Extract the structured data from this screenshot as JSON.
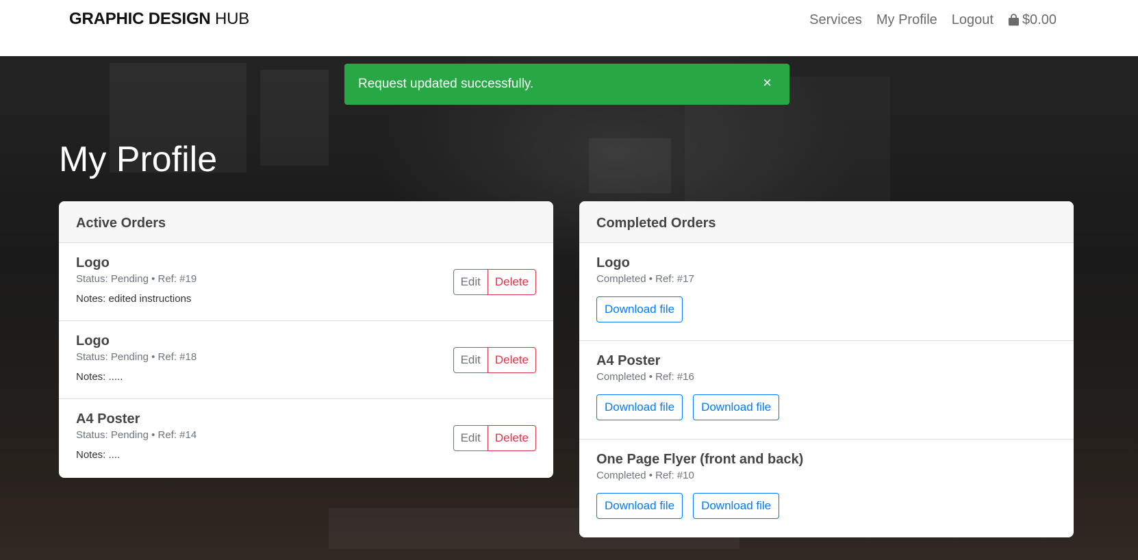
{
  "navbar": {
    "brand_bold": "GRAPHIC DESIGN",
    "brand_light": "HUB",
    "links": [
      "Services",
      "My Profile",
      "Logout"
    ],
    "cart_total": "$0.00"
  },
  "alert": {
    "message": "Request updated successfully.",
    "close": "×",
    "color": "#28a745"
  },
  "page": {
    "title": "My Profile"
  },
  "active_orders": {
    "header": "Active Orders",
    "edit_label": "Edit",
    "delete_label": "Delete",
    "items": [
      {
        "title": "Logo",
        "meta": "Status: Pending • Ref: #19",
        "notes": "Notes: edited instructions"
      },
      {
        "title": "Logo",
        "meta": "Status: Pending • Ref: #18",
        "notes": "Notes: ....."
      },
      {
        "title": "A4 Poster",
        "meta": "Status: Pending • Ref: #14",
        "notes": "Notes: ...."
      }
    ]
  },
  "completed_orders": {
    "header": "Completed Orders",
    "download_label": "Download file",
    "items": [
      {
        "title": "Logo",
        "meta": "Completed • Ref: #17",
        "downloads": 1
      },
      {
        "title": "A4 Poster",
        "meta": "Completed • Ref: #16",
        "downloads": 2
      },
      {
        "title": "One Page Flyer (front and back)",
        "meta": "Completed • Ref: #10",
        "downloads": 2
      }
    ]
  },
  "icons": {
    "cart": "shopping-bag-icon",
    "close": "close-icon"
  }
}
